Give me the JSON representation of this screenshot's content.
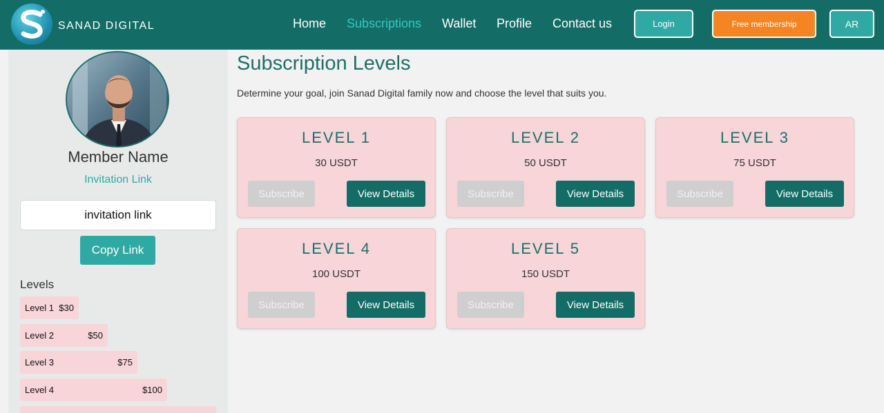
{
  "header": {
    "brand": "SANAD DIGITAL",
    "nav": [
      {
        "label": "Home",
        "active": false
      },
      {
        "label": "Subscriptions",
        "active": true
      },
      {
        "label": "Wallet",
        "active": false
      },
      {
        "label": "Profile",
        "active": false
      },
      {
        "label": "Contact us",
        "active": false
      }
    ],
    "login_label": "Login",
    "free_label": "Free membership",
    "lang_label": "AR"
  },
  "sidebar": {
    "member_name": "Member Name",
    "invitation_title": "Invitation Link",
    "invitation_value": "invitation link",
    "copy_label": "Copy Link",
    "levels_title": "Levels",
    "levels": [
      {
        "name": "Level 1",
        "price": "$30"
      },
      {
        "name": "Level 2",
        "price": "$50"
      },
      {
        "name": "Level 3",
        "price": "$75"
      },
      {
        "name": "Level 4",
        "price": "$100"
      }
    ]
  },
  "main": {
    "title": "Subscription Levels",
    "subtitle": "Determine your goal, join Sanad Digital family now and choose the level that suits you.",
    "cards": [
      {
        "title": "LEVEL 1",
        "price": "30 USDT",
        "subscribe": "Subscribe",
        "details": "View Details"
      },
      {
        "title": "LEVEL 2",
        "price": "50 USDT",
        "subscribe": "Subscribe",
        "details": "View Details"
      },
      {
        "title": "LEVEL 3",
        "price": "75 USDT",
        "subscribe": "Subscribe",
        "details": "View Details"
      },
      {
        "title": "LEVEL 4",
        "price": "100 USDT",
        "subscribe": "Subscribe",
        "details": "View Details"
      },
      {
        "title": "LEVEL 5",
        "price": "150 USDT",
        "subscribe": "Subscribe",
        "details": "View Details"
      }
    ]
  },
  "colors": {
    "header_bg": "#136d66",
    "accent": "#2fa9a3",
    "orange": "#f58422",
    "card_bg": "#f7d5d8",
    "title_teal": "#1e6f69"
  }
}
